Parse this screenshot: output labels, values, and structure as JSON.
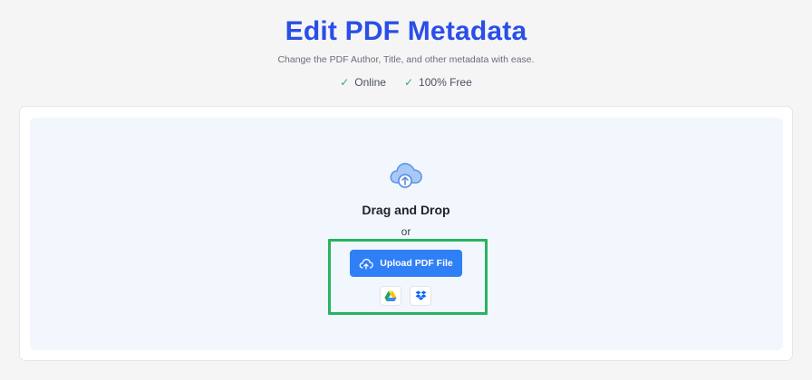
{
  "header": {
    "title": "Edit PDF Metadata",
    "subtitle": "Change the PDF Author, Title, and other metadata with ease."
  },
  "features": [
    {
      "icon": "check-icon",
      "label": "Online"
    },
    {
      "icon": "check-icon",
      "label": "100% Free"
    }
  ],
  "dropzone": {
    "icon": "cloud-upload-icon",
    "title": "Drag and Drop",
    "or_text": "or",
    "upload_label": "Upload PDF File",
    "sources": [
      {
        "name": "google-drive-icon"
      },
      {
        "name": "dropbox-icon"
      }
    ]
  },
  "colors": {
    "title": "#2a4ee8",
    "accent": "#2f7ff7",
    "check": "#2fae6a",
    "highlight": "#27b35f",
    "dropzone_bg": "#f2f7fe"
  }
}
